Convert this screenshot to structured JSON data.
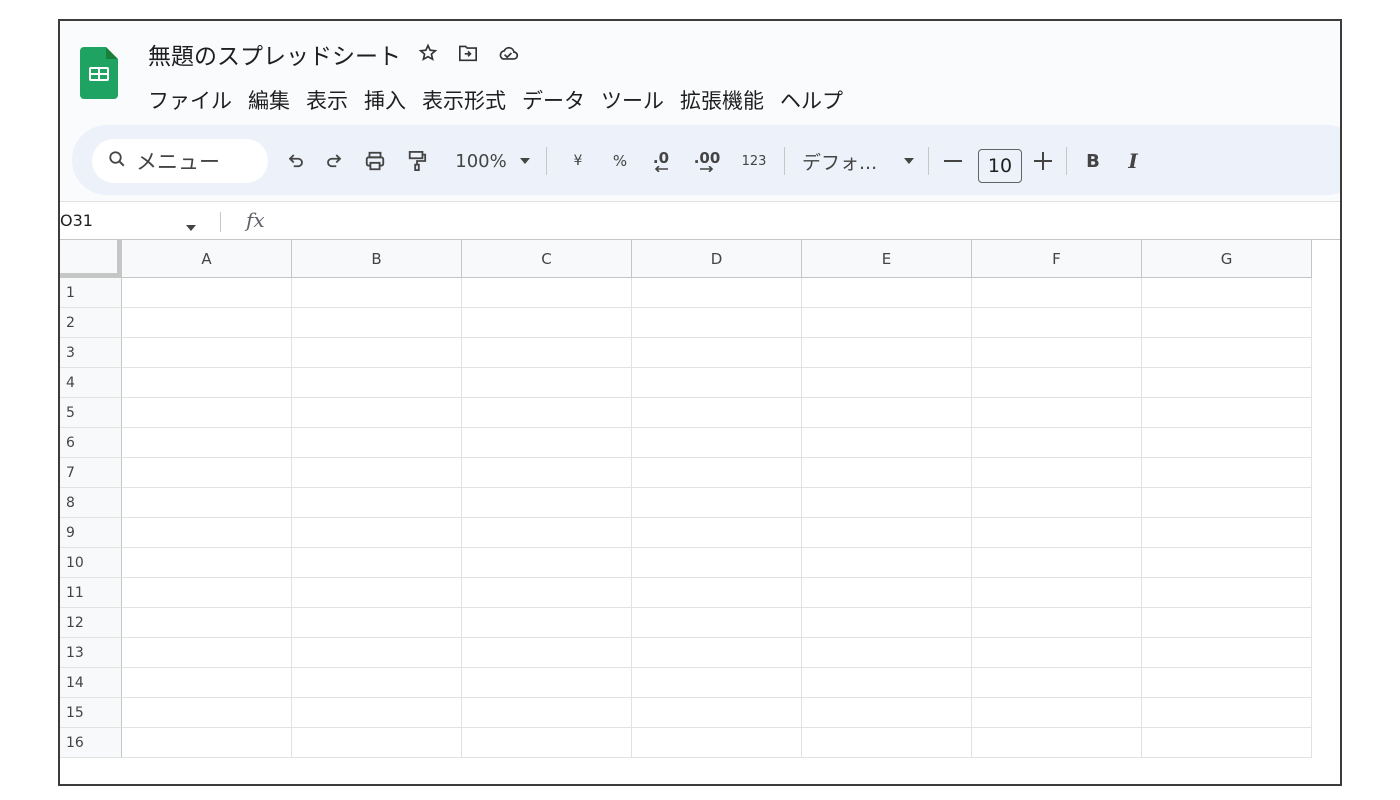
{
  "app": {
    "title": "無題のスプレッドシート",
    "brand_color": "#1ea362",
    "title_icons": [
      "star-icon",
      "move-to-folder-icon",
      "cloud-saved-icon"
    ]
  },
  "menu": [
    "ファイル",
    "編集",
    "表示",
    "挿入",
    "表示形式",
    "データ",
    "ツール",
    "拡張機能",
    "ヘルプ"
  ],
  "toolbar": {
    "search_label": "メニュー",
    "zoom": "100%",
    "currency": "¥",
    "percent": "%",
    "decrease_decimal": ".0",
    "increase_decimal": ".00",
    "number_format": "123",
    "font": "デフォ...",
    "font_size": "10",
    "bold": "B",
    "italic": "I"
  },
  "formula_bar": {
    "name_box": "O31",
    "fx": "fx"
  },
  "columns": [
    "A",
    "B",
    "C",
    "D",
    "E",
    "F",
    "G"
  ],
  "rows": [
    "1",
    "2",
    "3",
    "4",
    "5",
    "6",
    "7",
    "8",
    "9",
    "10",
    "11",
    "12",
    "13",
    "14",
    "15",
    "16"
  ]
}
